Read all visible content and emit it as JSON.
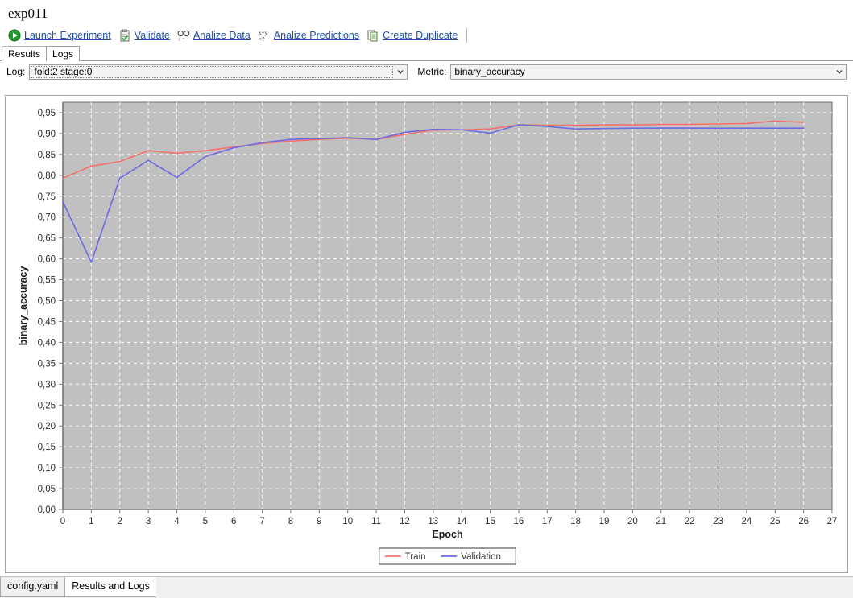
{
  "window": {
    "experiment_title": "exp011"
  },
  "toolbar": {
    "actions": [
      {
        "label": "Launch Experiment",
        "icon": "play-icon"
      },
      {
        "label": "Validate",
        "icon": "clipboard-check-icon"
      },
      {
        "label": "Analize Data",
        "icon": "glasses-icon"
      },
      {
        "label": "Analize Predictions",
        "icon": "formula-icon"
      },
      {
        "label": "Create Duplicate",
        "icon": "copy-document-icon"
      }
    ]
  },
  "top_tabs": [
    {
      "label": "Results",
      "active": false
    },
    {
      "label": "Logs",
      "active": true
    }
  ],
  "selectors": {
    "log_label": "Log:",
    "log_value": "fold:2 stage:0",
    "metric_label": "Metric:",
    "metric_value": "binary_accuracy"
  },
  "bottom_tabs": [
    {
      "label": "config.yaml",
      "active": false
    },
    {
      "label": "Results and Logs",
      "active": true
    }
  ],
  "colors": {
    "train": "#f4706b",
    "validation": "#6b6be6",
    "plot_background": "#c0c0c0",
    "gridline": "#ffffff",
    "axis": "#555555",
    "link": "#1e4faa"
  },
  "chart_data": {
    "type": "line",
    "title": "",
    "xlabel": "Epoch",
    "ylabel": "binary_accuracy",
    "xlim": [
      0,
      27
    ],
    "ylim": [
      0.0,
      0.975
    ],
    "grid": true,
    "legend_position": "bottom-center",
    "xticks": [
      0,
      1,
      2,
      3,
      4,
      5,
      6,
      7,
      8,
      9,
      10,
      11,
      12,
      13,
      14,
      15,
      16,
      17,
      18,
      19,
      20,
      21,
      22,
      23,
      24,
      25,
      26,
      27
    ],
    "yticks": [
      0.0,
      0.05,
      0.1,
      0.15,
      0.2,
      0.25,
      0.3,
      0.35,
      0.4,
      0.45,
      0.5,
      0.55,
      0.6,
      0.65,
      0.7,
      0.75,
      0.8,
      0.85,
      0.9,
      0.95
    ],
    "ytick_labels": [
      "0,00",
      "0,05",
      "0,10",
      "0,15",
      "0,20",
      "0,25",
      "0,30",
      "0,35",
      "0,40",
      "0,45",
      "0,50",
      "0,55",
      "0,60",
      "0,65",
      "0,70",
      "0,75",
      "0,80",
      "0,85",
      "0,90",
      "0,95"
    ],
    "x": [
      0,
      1,
      2,
      3,
      4,
      5,
      6,
      7,
      8,
      9,
      10,
      11,
      12,
      13,
      14,
      15,
      16,
      17,
      18,
      19,
      20,
      21,
      22,
      23,
      24,
      25,
      26
    ],
    "series": [
      {
        "name": "Train",
        "color": "#f4706b",
        "values": [
          0.793,
          0.822,
          0.833,
          0.859,
          0.853,
          0.859,
          0.868,
          0.876,
          0.882,
          0.886,
          0.889,
          0.886,
          0.898,
          0.908,
          0.909,
          0.911,
          0.921,
          0.92,
          0.92,
          0.921,
          0.921,
          0.922,
          0.922,
          0.923,
          0.924,
          0.93,
          0.927
        ]
      },
      {
        "name": "Validation",
        "color": "#6b6be6",
        "values": [
          0.737,
          0.592,
          0.793,
          0.836,
          0.795,
          0.845,
          0.866,
          0.878,
          0.886,
          0.888,
          0.89,
          0.886,
          0.903,
          0.91,
          0.909,
          0.901,
          0.921,
          0.917,
          0.911,
          0.912,
          0.913,
          0.913,
          0.913,
          0.913,
          0.913,
          0.913,
          0.913
        ]
      }
    ]
  }
}
